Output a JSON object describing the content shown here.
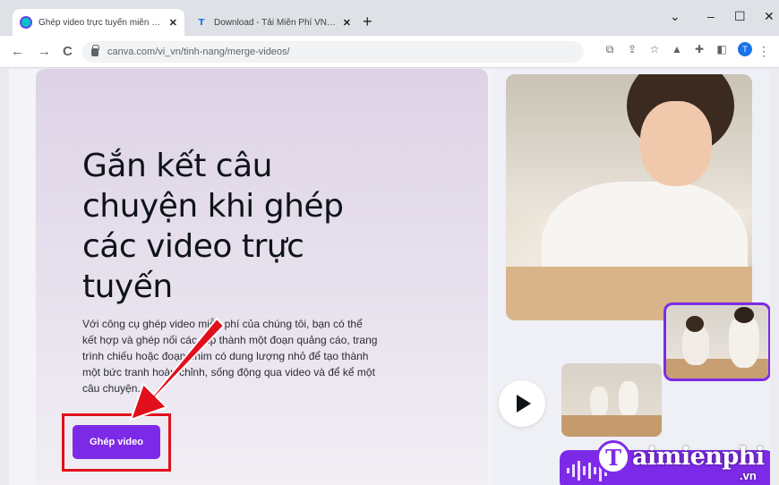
{
  "browser": {
    "tabs": [
      {
        "label": "Ghép video trực tuyến miễn phí",
        "icon": "canva-favicon",
        "active": true
      },
      {
        "label": "Download - Tải Miễn Phí VN - Ph",
        "icon": "taimienphi-favicon",
        "active": false
      }
    ],
    "new_tab_symbol": "+",
    "close_symbol": "✕",
    "window_controls": {
      "chevron": "⌄",
      "minimize": "–",
      "maximize": "☐",
      "close": "✕"
    },
    "nav": {
      "back": "←",
      "forward": "→",
      "reload": "C"
    },
    "url": "canva.com/vi_vn/tinh-nang/merge-videos/",
    "profile_initial": "T",
    "kebab": "⋮"
  },
  "hero": {
    "headline": "Gắn kết câu chuyện khi ghép các video trực tuyến",
    "description": "Với công cụ ghép video miễn phí của chúng tôi, bạn có thể kết hợp và ghép nối các clip thành một đoạn quảng cáo, trang trình chiếu hoặc đoạn phim có dung lượng nhỏ để tạo thành một bức tranh hoàn chỉnh, sống động qua video và để kể một câu chuyện.",
    "cta_label": "Ghép video"
  },
  "watermark": {
    "initial": "T",
    "text": "aimienphi",
    "suffix": ".vn"
  },
  "colors": {
    "accent": "#7d2ae8",
    "highlight_box": "#e10f1c",
    "arrow": "#e10f1c"
  }
}
